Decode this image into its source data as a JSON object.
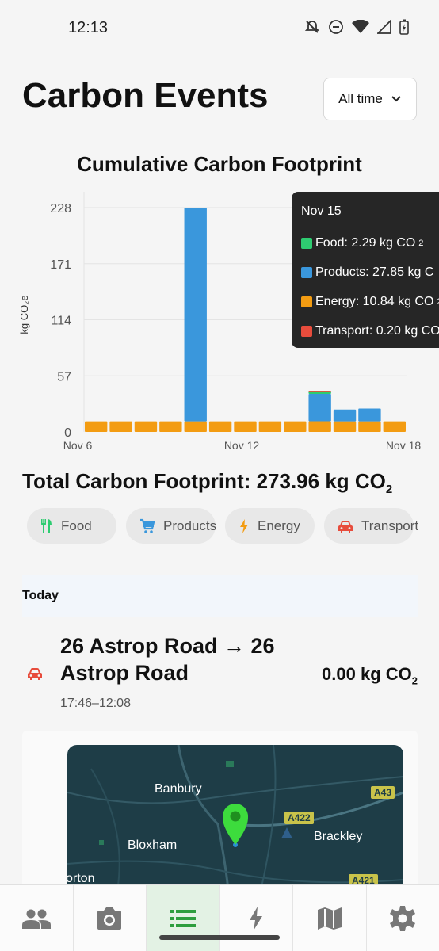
{
  "status_bar": {
    "time": "12:13"
  },
  "header": {
    "title": "Carbon Events",
    "range_label": "All time"
  },
  "chart_title": "Cumulative Carbon Footprint",
  "chart_data": {
    "type": "bar",
    "title": "Cumulative Carbon Footprint",
    "ylabel": "kg CO₂e",
    "xlabel": "",
    "y_ticks": [
      "0",
      "57",
      "114",
      "171",
      "228"
    ],
    "x_tick_labels": [
      "Nov 6",
      "Nov 12",
      "Nov 18"
    ],
    "ylim": [
      0,
      228
    ],
    "categories": [
      "Nov 6",
      "Nov 7",
      "Nov 8",
      "Nov 9",
      "Nov 10",
      "Nov 11",
      "Nov 12",
      "Nov 13",
      "Nov 14",
      "Nov 15",
      "Nov 16",
      "Nov 17",
      "Nov 18"
    ],
    "stacked": true,
    "series": [
      {
        "name": "Energy",
        "color": "#f39c12",
        "values": [
          10.8,
          10.8,
          10.8,
          10.8,
          10.8,
          10.8,
          10.8,
          10.8,
          10.8,
          10.84,
          10.8,
          10.8,
          10.8
        ]
      },
      {
        "name": "Products",
        "color": "#3a97dc",
        "values": [
          0,
          0,
          0,
          0,
          217,
          0,
          0,
          0,
          0,
          27.85,
          12,
          13
        ]
      },
      {
        "name": "Food",
        "color": "#2ecc71",
        "values": [
          0,
          0,
          0,
          0,
          0,
          0,
          0,
          0,
          0,
          2.29,
          0,
          0,
          0
        ]
      },
      {
        "name": "Transport",
        "color": "#e74c3c",
        "values": [
          0,
          0,
          0,
          0,
          0,
          0,
          0,
          0,
          0,
          0.2,
          0,
          0,
          0
        ]
      }
    ],
    "grid": true,
    "legend": "none"
  },
  "tooltip": {
    "date": "Nov 15",
    "rows": [
      {
        "label": "Food: 2.29 kg CO",
        "sub": "2",
        "color": "#2ecc71"
      },
      {
        "label": "Products: 27.85 kg C",
        "sub": "",
        "color": "#3a97dc"
      },
      {
        "label": "Energy: 10.84 kg CO",
        "sub": "2",
        "color": "#f39c12"
      },
      {
        "label": "Transport: 0.20 kg CO",
        "sub": "",
        "color": "#e74c3c"
      }
    ]
  },
  "total": {
    "label": "Total Carbon Footprint: 273.96 kg CO",
    "sub": "2"
  },
  "filters": [
    {
      "label": "Food",
      "icon": "fork-knife-icon",
      "color": "#2ecc71"
    },
    {
      "label": "Products",
      "icon": "cart-icon",
      "color": "#3a97dc"
    },
    {
      "label": "Energy",
      "icon": "bolt-icon",
      "color": "#f39c12"
    },
    {
      "label": "Transport",
      "icon": "car-icon",
      "color": "#e74c3c"
    }
  ],
  "section": {
    "label": "Today"
  },
  "event": {
    "title": "26 Astrop Road → 26 Astrop Road",
    "time": "17:46–12:08",
    "amount": "0.00 kg CO",
    "amount_sub": "2",
    "icon": "car-icon"
  },
  "map": {
    "labels": [
      "Banbury",
      "Bloxham",
      "Brackley",
      "orton"
    ],
    "roads": [
      "A422",
      "A43",
      "A421"
    ]
  },
  "nav": [
    {
      "icon": "people-icon"
    },
    {
      "icon": "camera-icon"
    },
    {
      "icon": "list-icon",
      "active": true
    },
    {
      "icon": "bolt-icon"
    },
    {
      "icon": "map-icon"
    },
    {
      "icon": "gear-icon"
    }
  ]
}
